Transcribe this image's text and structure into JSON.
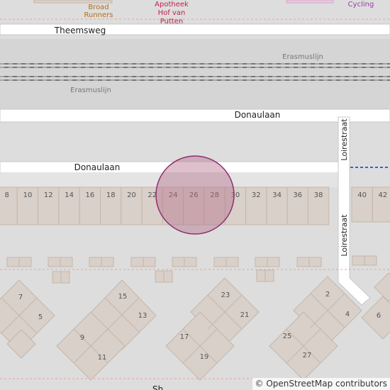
{
  "map": {
    "colors": {
      "background": "#dddddd",
      "road": "#ffffff",
      "road_casing": "#c8c8c8",
      "building": "#d9d0c9",
      "building_stroke": "#c4b6ab",
      "rail": "#777777",
      "boundary": "#e9a3a3",
      "paved": "#e4e4e4",
      "marker_fill": "#b5728d",
      "marker_stroke": "#8e2f6e",
      "dashed_line": "#3b5bdb",
      "pink_area": "#e8c7e0",
      "poi_brown": "#b07019",
      "poi_red": "#c0224b",
      "poi_purple": "#9a3aa6"
    },
    "poi": {
      "broad_runners": [
        "Broad",
        "Runners"
      ],
      "apotheek": [
        "Apotheek",
        "Hof van",
        "Putten"
      ],
      "cycling": "Cycling"
    },
    "streets": {
      "theemsweg": "Theemsweg",
      "erasmuslijn_upper": "Erasmuslijn",
      "erasmuslijn_lower": "Erasmuslijn",
      "donaulaan_upper": "Donaulaan",
      "donaulaan_lower": "Donaulaan",
      "loirestraat_upper": "Loirestraat",
      "loirestraat_lower": "Loirestraat",
      "bottom_partial": "Sh"
    },
    "house_numbers": {
      "row": [
        "8",
        "10",
        "12",
        "14",
        "16",
        "18",
        "20",
        "22",
        "24",
        "26",
        "28",
        "30",
        "32",
        "34",
        "36",
        "38",
        "40",
        "42"
      ],
      "block1": [
        "7",
        "5"
      ],
      "block2": [
        "15",
        "13",
        "9",
        "11"
      ],
      "block3": [
        "23",
        "21",
        "17",
        "19"
      ],
      "block4": [
        "2",
        "4",
        "25",
        "27"
      ],
      "block5": [
        "6"
      ]
    }
  },
  "attribution": {
    "symbol": "©",
    "link_text": "OpenStreetMap",
    "suffix": "contributors"
  }
}
